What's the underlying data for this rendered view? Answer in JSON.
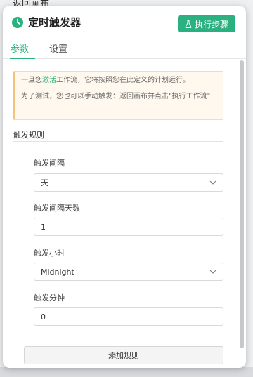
{
  "backdrop": {
    "title": "返回画布"
  },
  "panel": {
    "title": "定时触发器",
    "execute_button": "执行步骤"
  },
  "tabs": [
    {
      "label": "参数",
      "active": true
    },
    {
      "label": "设置",
      "active": false
    }
  ],
  "notice": {
    "line1_before": "一旦您",
    "line1_link": "激活",
    "line1_after": "工作流，它将按照您在此定义的计划运行。",
    "line2": "为了测试，您也可以手动触发：返回画布并点击\"执行工作流\""
  },
  "section": {
    "title": "触发规则"
  },
  "fields": [
    {
      "label": "触发间隔",
      "type": "select",
      "value": "天"
    },
    {
      "label": "触发间隔天数",
      "type": "input",
      "value": "1"
    },
    {
      "label": "触发小时",
      "type": "select",
      "value": "Midnight"
    },
    {
      "label": "触发分钟",
      "type": "input",
      "value": "0"
    }
  ],
  "add_rule_button": "添加规则",
  "colors": {
    "accent": "#2bb07f",
    "notice_bg": "#fef8ee",
    "notice_border": "#f3c27b"
  },
  "icons": {
    "header": "clock-icon",
    "execute": "flask-icon",
    "select": "chevron-down-icon"
  }
}
